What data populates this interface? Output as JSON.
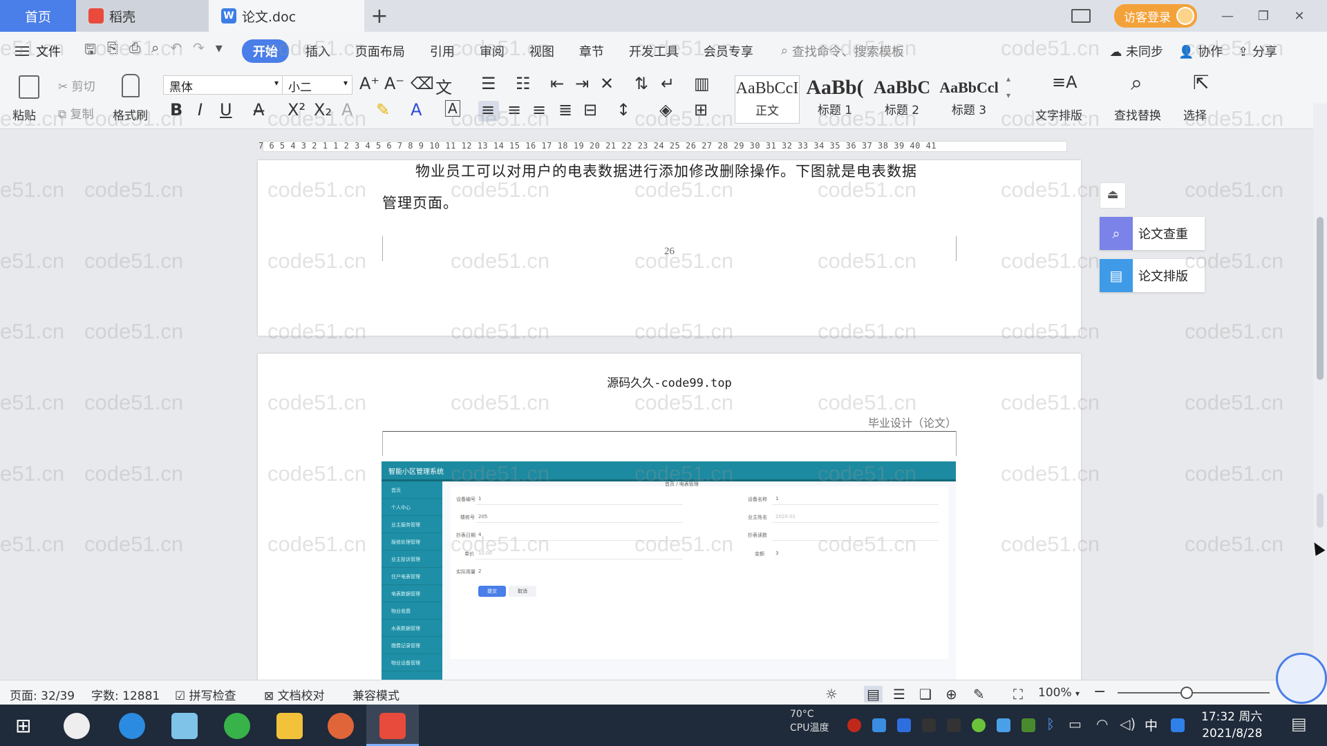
{
  "titlebar": {
    "tabs": [
      {
        "label": "首页"
      },
      {
        "label": "稻壳"
      },
      {
        "label": "论文.doc"
      }
    ],
    "add_tab": "+",
    "login": "访客登录"
  },
  "menu": {
    "file": "文件",
    "items": [
      "开始",
      "插入",
      "页面布局",
      "引用",
      "审阅",
      "视图",
      "章节",
      "开发工具",
      "会员专享"
    ],
    "search_placeholder": "查找命令、搜索模板",
    "right": [
      "未同步",
      "协作",
      "分享"
    ]
  },
  "ribbon": {
    "paste": "粘贴",
    "cut": "剪切",
    "copy": "复制",
    "format_painter": "格式刷",
    "font_name": "黑体",
    "font_size": "小二",
    "styles": [
      {
        "sample": "AaBbCcI",
        "label": "正文"
      },
      {
        "sample": "AaBb(",
        "label": "标题 1"
      },
      {
        "sample": "AaBbC",
        "label": "标题 2"
      },
      {
        "sample": "AaBbCcl",
        "label": "标题 3"
      }
    ],
    "text_layout": "文字排版",
    "find_replace": "查找替换",
    "select": "选择"
  },
  "ruler": {
    "numbers": "7  6  5  4  3  2  1     1  2  3  4  5  6  7  8  9  10 11 12 13 14 15 16 17 18 19 20 21 22 23 24 25 26 27 28 29 30 31 32 33 34 35 36 37 38 39 40 41"
  },
  "document": {
    "page1_line1": "物业员工可以对用户的电表数据进行添加修改删除操作。下图就是电表数据",
    "page1_line2": "管理页面。",
    "page_number": "26",
    "page2_header": "源码久久-code99.top",
    "page2_header_right": "毕业设计（论文）",
    "screenshot": {
      "system_title": "智能小区管理系统",
      "breadcrumb": "首页 / 电表管理",
      "sidebar_items": [
        "首页",
        "个人中心",
        "业主服务管理",
        "报修处理管理",
        "业主投诉管理",
        "住户电表管理",
        "电表数据管理",
        "物业收费",
        "水表数据管理",
        "缴费记录管理",
        "物业设备管理"
      ],
      "field_labels": [
        "设备编号",
        "楼栋号",
        "抄表日期",
        "单价",
        "实际用量",
        "设备名称",
        "业主姓名",
        "抄表读数",
        "金额"
      ],
      "field_values": [
        "1",
        "205",
        "4",
        "10.00",
        "2",
        "1",
        "2020-01",
        "",
        "3"
      ],
      "submit": "提交",
      "cancel": "取消"
    }
  },
  "float_panel": {
    "check": "论文查重",
    "layout": "论文排版"
  },
  "statusbar": {
    "page": "页面: 32/39",
    "words": "字数: 12881",
    "spell": "拼写检查",
    "proof": "文档校对",
    "compat": "兼容模式",
    "zoom": "100%"
  },
  "taskbar": {
    "temp_line1": "70°C",
    "temp_line2": "CPU温度",
    "ime": "中",
    "time": "17:32 周六",
    "date": "2021/8/28"
  },
  "watermark": "code51.cn",
  "colors": {
    "accent": "#4a7ee8",
    "login": "#f3a23a",
    "teal": "#1c8aa0",
    "taskbar": "#1f2a3a"
  }
}
